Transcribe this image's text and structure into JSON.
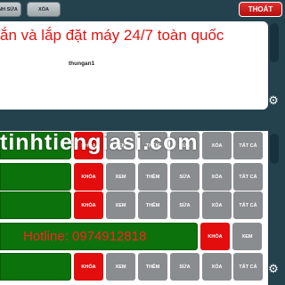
{
  "toolbar": {
    "edit_label": "NH SỬA",
    "delete_label": "XÓA",
    "exit_label": "THOÁT"
  },
  "notice": {
    "marquee_text": "ắn và lắp đặt máy 24/7 toàn quốc",
    "username": "thungan1"
  },
  "watermark": "tinhtiengiasi.com",
  "hotline": "Hotline: 0974912818",
  "colors": {
    "background": "#24424e",
    "exit": "#d41a1a",
    "lock": "#e30d0d",
    "perm": "#8a8d8f",
    "user": "#0c720c"
  },
  "perm_labels": {
    "lock": "KHÓA",
    "view": "XEM",
    "add": "THÊM",
    "edit": "SỬA",
    "delete": "XÓA",
    "all": "TẤT CẢ"
  },
  "icons": {
    "settings": "gear-icon"
  }
}
